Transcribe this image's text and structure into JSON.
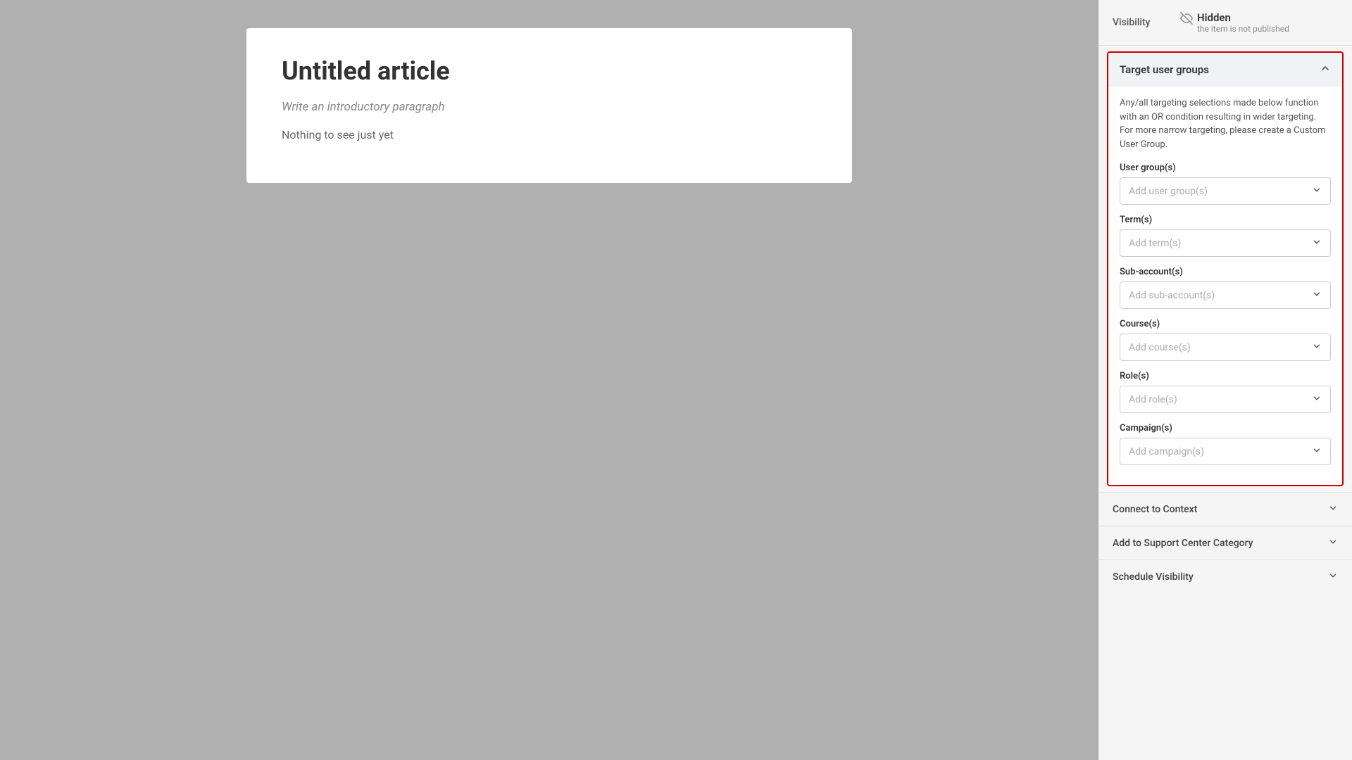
{
  "main": {
    "article_title": "Untitled article",
    "article_intro": "Write an introductory paragraph",
    "article_empty": "Nothing to see just yet"
  },
  "sidebar": {
    "visibility": {
      "label": "Visibility",
      "icon_label": "hidden-eye-icon",
      "status": "Hidden",
      "subtitle": "the item is not published"
    },
    "target_panel": {
      "title": "Target user groups",
      "description": "Any/all targeting selections made below function with an OR condition resulting in wider targeting. For more narrow targeting, please create a Custom User Group.",
      "fields": [
        {
          "label": "User group(s)",
          "placeholder": "Add user group(s)"
        },
        {
          "label": "Term(s)",
          "placeholder": "Add term(s)"
        },
        {
          "label": "Sub-account(s)",
          "placeholder": "Add sub-account(s)"
        },
        {
          "label": "Course(s)",
          "placeholder": "Add course(s)"
        },
        {
          "label": "Role(s)",
          "placeholder": "Add role(s)"
        },
        {
          "label": "Campaign(s)",
          "placeholder": "Add campaign(s)"
        }
      ]
    },
    "collapsed_sections": [
      {
        "label": "Connect to Context"
      },
      {
        "label": "Add to Support Center Category"
      },
      {
        "label": "Schedule Visibility"
      }
    ]
  }
}
